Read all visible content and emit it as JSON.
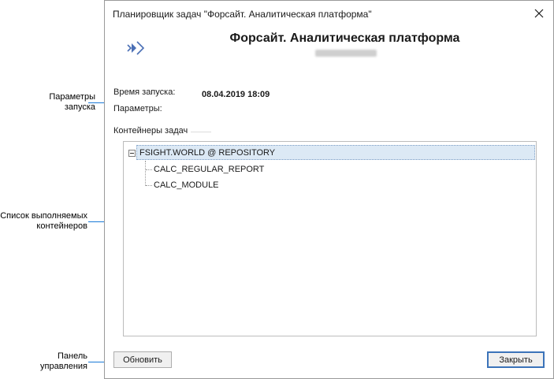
{
  "annotations": [
    {
      "id": "launch-params",
      "lines": [
        "Параметры",
        "запуска"
      ]
    },
    {
      "id": "containers-list",
      "lines": [
        "Список выполняемых",
        "контейнеров"
      ]
    },
    {
      "id": "control-panel",
      "lines": [
        "Панель",
        "управления"
      ]
    }
  ],
  "window": {
    "title": "Планировщик задач \"Форсайт. Аналитическая платформа\"",
    "close_icon": "close-icon"
  },
  "header": {
    "app_name": "Форсайт. Аналитическая платформа",
    "icon": "foresight-logo-icon"
  },
  "params": {
    "launch_time_label": "Время запуска:",
    "launch_time_value": "08.04.2019 18:09",
    "parameters_label": "Параметры:"
  },
  "containers": {
    "caption": "Контейнеры задач",
    "tree": {
      "root": "FSIGHT.WORLD @ REPOSITORY",
      "children": [
        "CALC_REGULAR_REPORT",
        "CALC_MODULE"
      ]
    }
  },
  "footer": {
    "refresh_label": "Обновить",
    "close_label": "Закрыть"
  },
  "colors": {
    "accent": "#1a7ad8",
    "selection": "#dce9f5",
    "icon": "#4a6fb5"
  }
}
